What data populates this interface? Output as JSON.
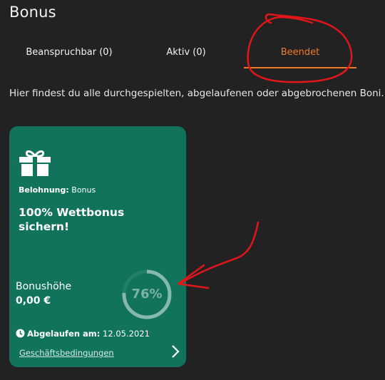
{
  "header": {
    "title": "Bonus"
  },
  "tabs": [
    {
      "label": "Beanspruchbar (0)",
      "active": false
    },
    {
      "label": "Aktiv (0)",
      "active": false
    },
    {
      "label": "Beendet",
      "active": true
    }
  ],
  "intro_text": "Hier findest du alle durchgespielten, abgelaufenen oder abgebrochenen Boni.",
  "card": {
    "icon": "gift-icon",
    "reward_label": "Belohnung:",
    "reward_value": "Bonus",
    "title": "100% Wettbonus sichern!",
    "amount_label": "Bonushöhe",
    "amount_value": "0,00 €",
    "progress_text": "76%",
    "progress_fraction": 0.76,
    "expired_label": "Abgelaufen am:",
    "expired_date": "12.05.2021",
    "terms_link": "Geschäftsbedingungen"
  },
  "colors": {
    "background": "#222222",
    "accent": "#f07a28",
    "card_background": "#11735c",
    "annotation": "#e0161b"
  }
}
